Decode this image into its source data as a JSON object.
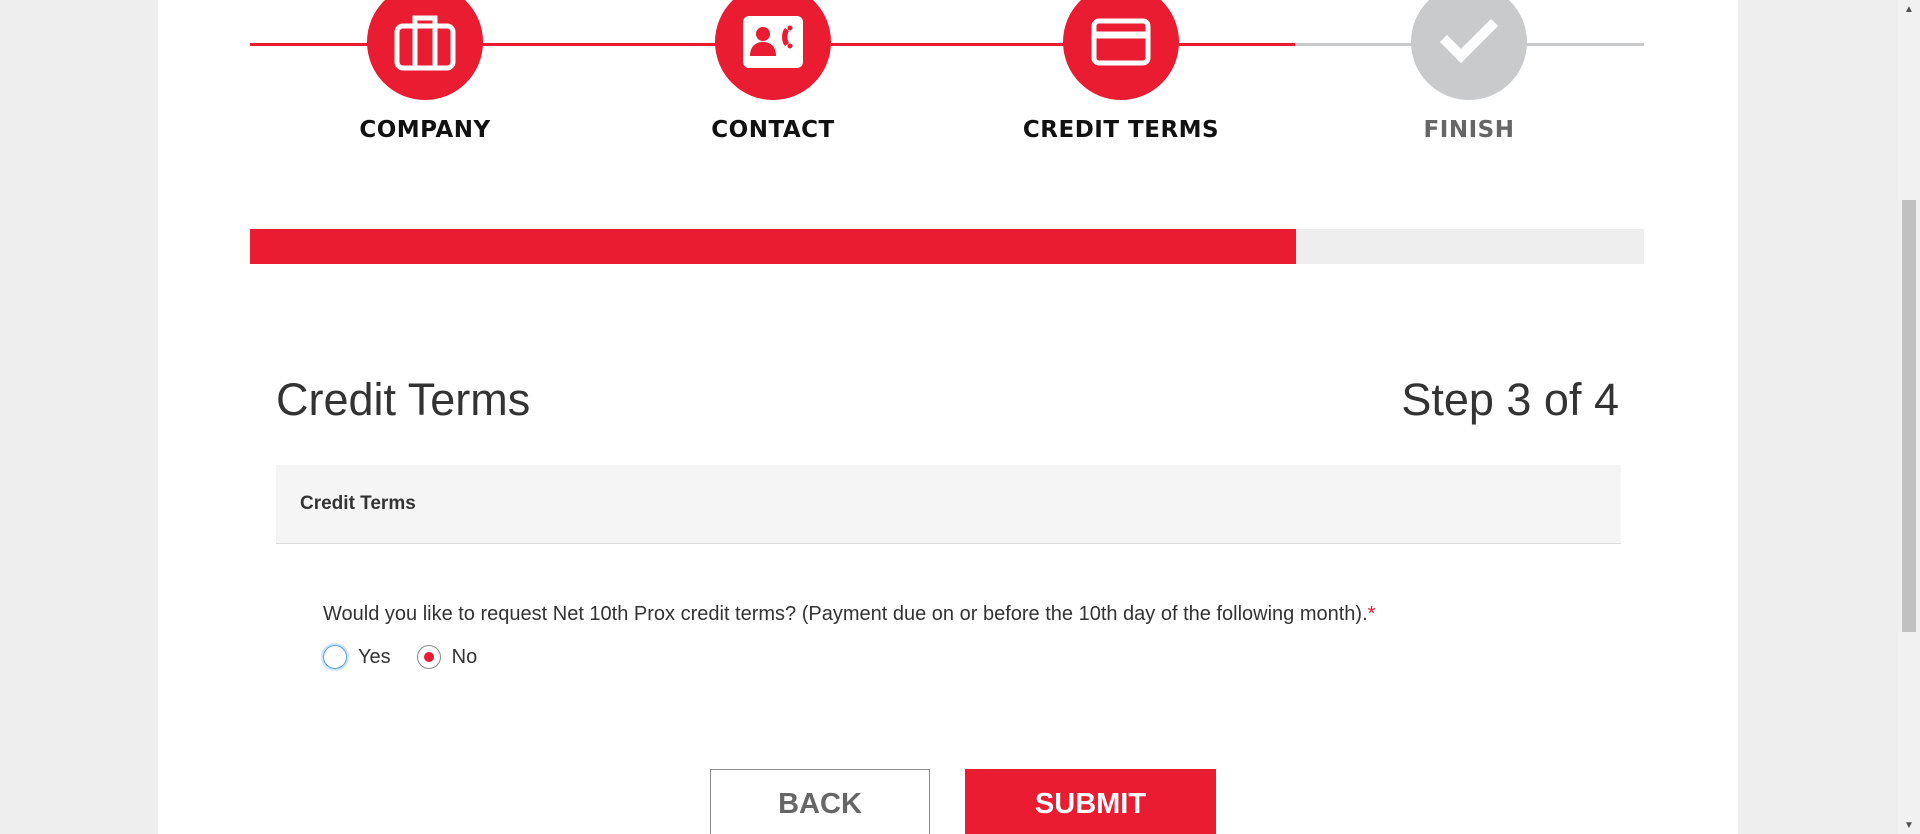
{
  "stepper": {
    "steps": [
      {
        "label": "COMPANY",
        "icon": "briefcase-icon",
        "state": "done"
      },
      {
        "label": "CONTACT",
        "icon": "contact-card-icon",
        "state": "done"
      },
      {
        "label": "CREDIT TERMS",
        "icon": "credit-card-icon",
        "state": "current"
      },
      {
        "label": "FINISH",
        "icon": "checkmark-icon",
        "state": "pending"
      }
    ]
  },
  "progress": {
    "fraction": 0.75
  },
  "colors": {
    "accent": "#e91c31",
    "inactive": "#c8cacc",
    "text": "#333333",
    "muted": "#666666"
  },
  "header": {
    "title": "Credit Terms",
    "step_count": "Step 3 of 4"
  },
  "panel": {
    "title": "Credit Terms"
  },
  "question": {
    "text": "Would you like to request Net 10th Prox credit terms? (Payment due on or before the 10th day of the following month).",
    "required_mark": "*",
    "options": [
      {
        "label": "Yes",
        "checked": false
      },
      {
        "label": "No",
        "checked": true
      }
    ]
  },
  "buttons": {
    "back": "BACK",
    "submit": "SUBMIT"
  }
}
